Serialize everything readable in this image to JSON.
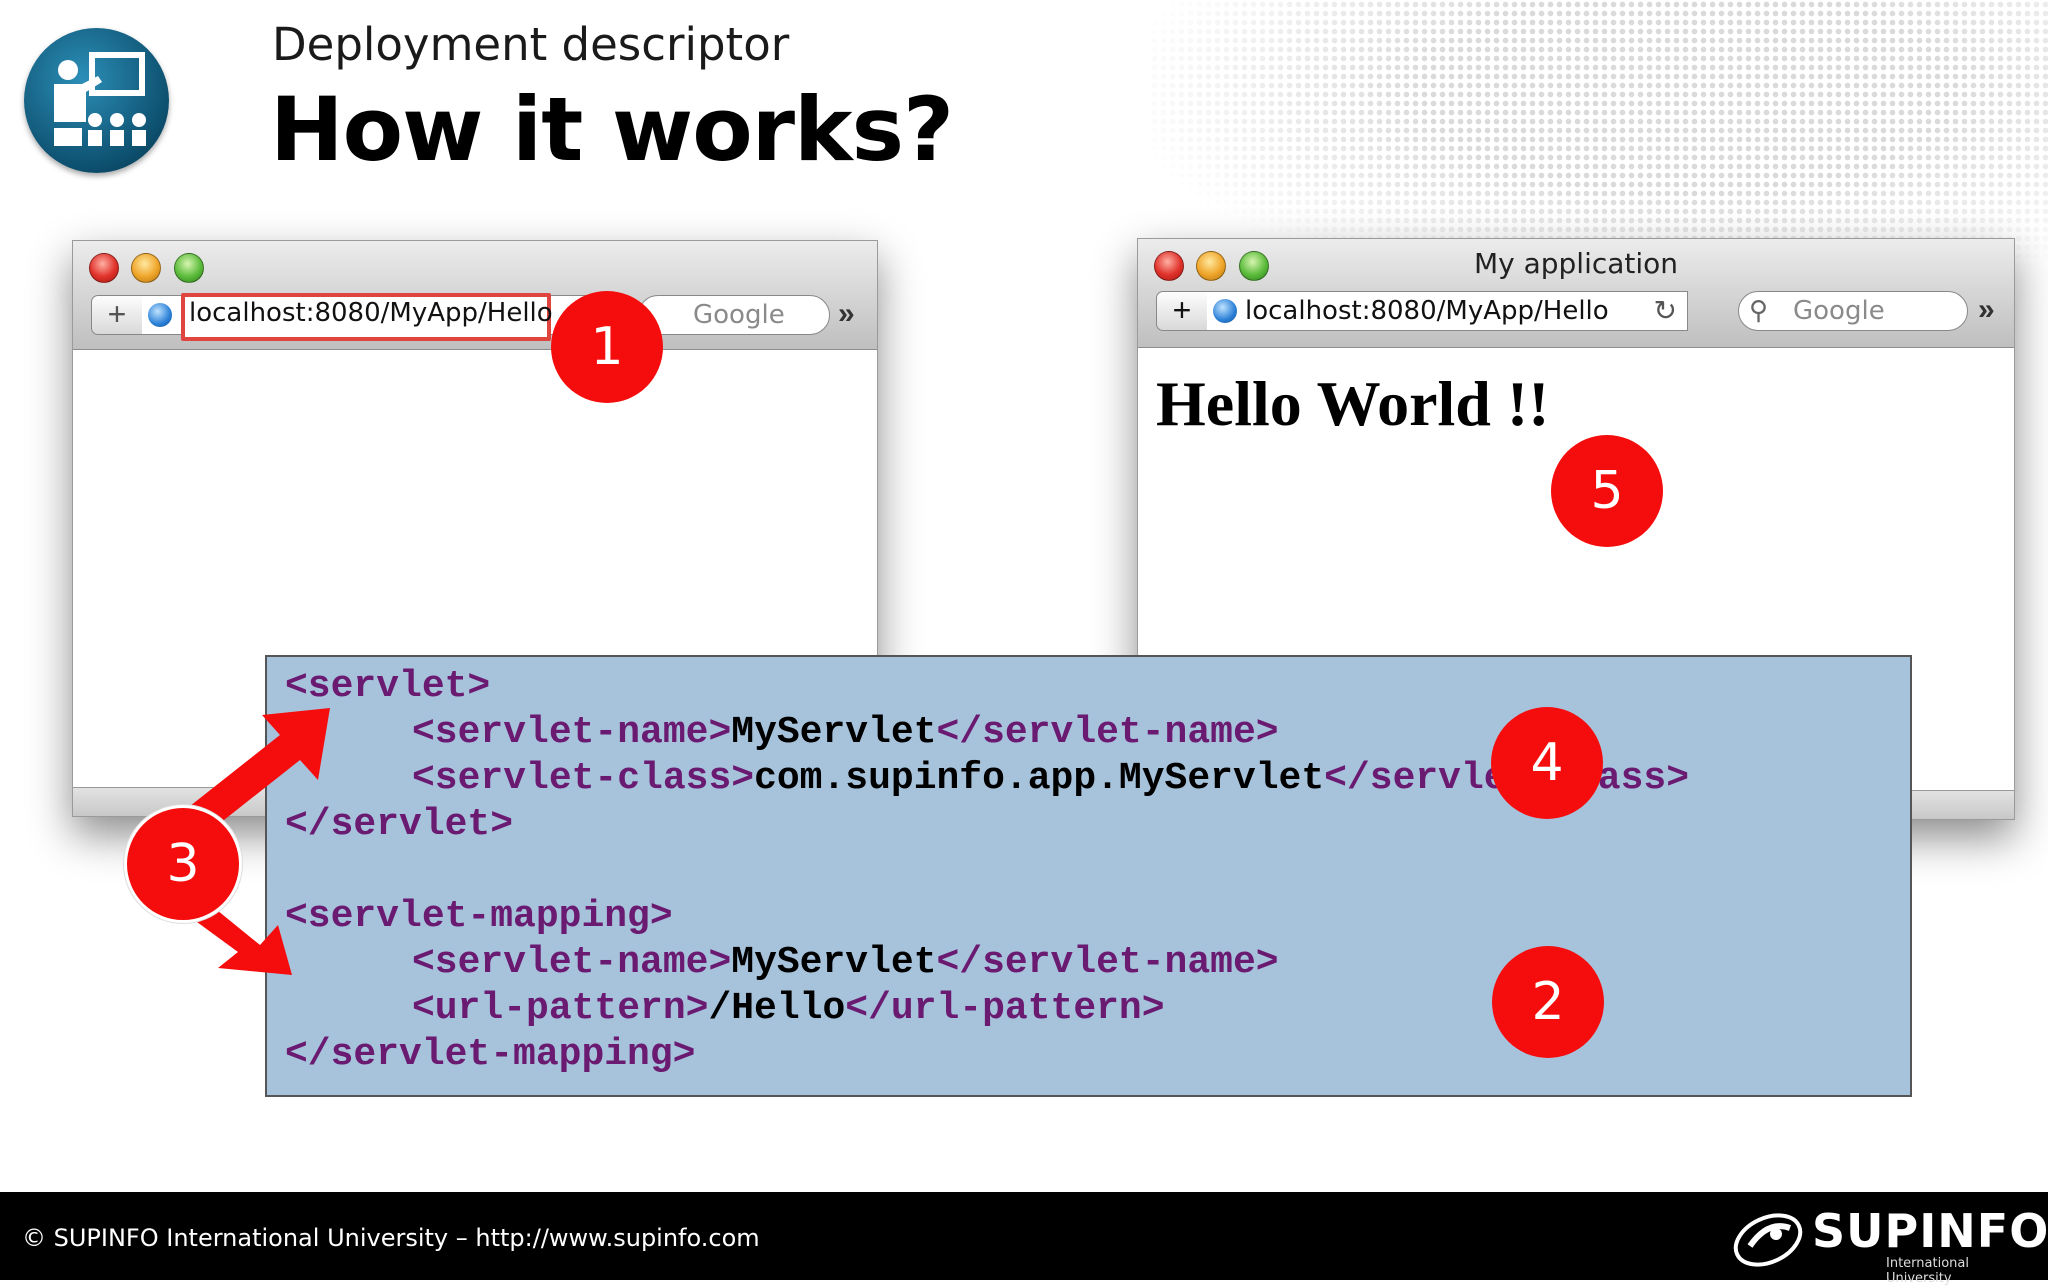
{
  "slide": {
    "subtitle": "Deployment descriptor",
    "title": "How it works?"
  },
  "browser_left": {
    "url": "localhost:8080/MyApp/Hello",
    "search_placeholder": "Google",
    "plus_label": "+",
    "overflow_label": "»"
  },
  "browser_right": {
    "window_title": "My application",
    "url": "localhost:8080/MyApp/Hello",
    "search_placeholder": "Google",
    "plus_label": "+",
    "overflow_label": "»",
    "page_heading": "Hello World !!"
  },
  "code": {
    "l1": "<servlet>",
    "l2_open": "<servlet-name>",
    "l2_val": "MyServlet",
    "l2_close": "</servlet-name>",
    "l3_open": "<servlet-class>",
    "l3_val": "com.supinfo.app.MyServlet",
    "l3_close": "</servlet-class>",
    "l4": "</servlet>",
    "l5": "<servlet-mapping>",
    "l6_open": "<servlet-name>",
    "l6_val": "MyServlet",
    "l6_close": "</servlet-name>",
    "l7_open": "<url-pattern>",
    "l7_val": "/Hello",
    "l7_close": "</url-pattern>",
    "l8": "</servlet-mapping>"
  },
  "steps": [
    "1",
    "2",
    "3",
    "4",
    "5"
  ],
  "footer": {
    "copyright": "© SUPINFO International University – http://www.supinfo.com",
    "brand_name": "SUPINFO",
    "brand_sub": "International University"
  },
  "colors": {
    "step_badge": "#f50c0c",
    "code_background": "#a7c3dc",
    "code_tag": "#6a1a70",
    "url_highlight": "#e0443f"
  },
  "icons": {
    "logo": "teacher-board-icon",
    "globe": "globe-icon",
    "search": "search-icon",
    "reload": "reload-icon",
    "overflow": "chevron-double-right-icon"
  }
}
